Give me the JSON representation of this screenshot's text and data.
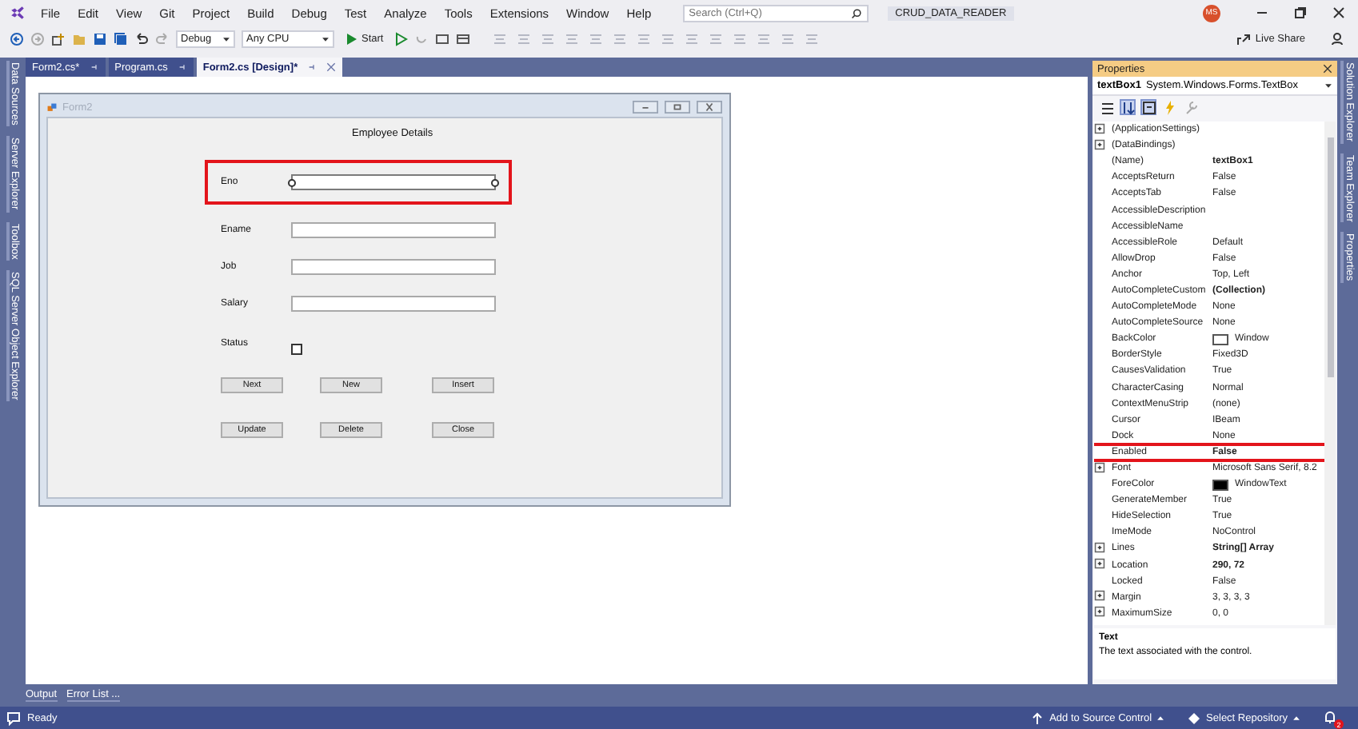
{
  "menu": [
    "File",
    "Edit",
    "View",
    "Git",
    "Project",
    "Build",
    "Debug",
    "Test",
    "Analyze",
    "Tools",
    "Extensions",
    "Window",
    "Help"
  ],
  "search": {
    "placeholder": "Search (Ctrl+Q)"
  },
  "solution_name": "CRUD_DATA_READER",
  "user_initials": "MS",
  "toolbar": {
    "configuration": "Debug",
    "platform": "Any CPU",
    "start": "Start",
    "live_share": "Live Share"
  },
  "left_tool_tabs": [
    "Data Sources",
    "Server Explorer",
    "Toolbox",
    "SQL Server Object Explorer"
  ],
  "doc_tabs": [
    {
      "label": "Form2.cs*",
      "selected": false
    },
    {
      "label": "Program.cs",
      "selected": false
    },
    {
      "label": "Form2.cs [Design]*",
      "selected": true
    }
  ],
  "form": {
    "title": "Form2",
    "heading": "Employee Details",
    "fields": [
      {
        "kind": "text",
        "label": "Eno",
        "selected": true
      },
      {
        "kind": "text",
        "label": "Ename",
        "selected": false
      },
      {
        "kind": "text",
        "label": "Job",
        "selected": false
      },
      {
        "kind": "text",
        "label": "Salary",
        "selected": false
      },
      {
        "kind": "checkbox",
        "label": "Status",
        "selected": false,
        "checked": false
      }
    ],
    "button_rows": [
      [
        "Next",
        "New",
        "Insert"
      ],
      [
        "Update",
        "Delete",
        "Close"
      ]
    ]
  },
  "properties": {
    "title": "Properties",
    "object": "textBox1",
    "type": "System.Windows.Forms.TextBox",
    "rows": [
      {
        "name": "(ApplicationSettings)",
        "expandable": true,
        "highlighted": false
      },
      {
        "name": "(DataBindings)",
        "expandable": true,
        "highlighted": false
      },
      {
        "name": "(Name)",
        "value": "textBox1",
        "expandable": false,
        "bold": true,
        "highlighted": false
      },
      {
        "name": "AcceptsReturn",
        "value": "False",
        "expandable": false,
        "bold": false,
        "highlighted": false
      },
      {
        "name": "AcceptsTab",
        "value": "False",
        "expandable": false,
        "bold": false,
        "highlighted": false
      },
      {
        "name": "AccessibleDescription",
        "expandable": false,
        "highlighted": false
      },
      {
        "name": "AccessibleName",
        "expandable": false,
        "highlighted": false
      },
      {
        "name": "AccessibleRole",
        "value": "Default",
        "expandable": false,
        "bold": false,
        "highlighted": false
      },
      {
        "name": "AllowDrop",
        "value": "False",
        "expandable": false,
        "bold": false,
        "highlighted": false
      },
      {
        "name": "Anchor",
        "value": "Top, Left",
        "expandable": false,
        "bold": false,
        "highlighted": false
      },
      {
        "name": "AutoCompleteCustom",
        "value": "(Collection)",
        "expandable": false,
        "bold": true,
        "highlighted": false
      },
      {
        "name": "AutoCompleteMode",
        "value": "None",
        "expandable": false,
        "bold": false,
        "highlighted": false
      },
      {
        "name": "AutoCompleteSource",
        "value": "None",
        "expandable": false,
        "bold": false,
        "highlighted": false
      },
      {
        "name": "BackColor",
        "value": "Window",
        "expandable": false,
        "bold": false,
        "highlighted": false,
        "color": "#ffffff"
      },
      {
        "name": "BorderStyle",
        "value": "Fixed3D",
        "expandable": false,
        "bold": false,
        "highlighted": false
      },
      {
        "name": "CausesValidation",
        "value": "True",
        "expandable": false,
        "bold": false,
        "highlighted": false
      },
      {
        "name": "CharacterCasing",
        "value": "Normal",
        "expandable": false,
        "bold": false,
        "highlighted": false
      },
      {
        "name": "ContextMenuStrip",
        "value": "(none)",
        "expandable": false,
        "bold": false,
        "highlighted": false
      },
      {
        "name": "Cursor",
        "value": "IBeam",
        "expandable": false,
        "bold": false,
        "highlighted": false
      },
      {
        "name": "Dock",
        "value": "None",
        "expandable": false,
        "bold": false,
        "highlighted": false
      },
      {
        "name": "Enabled",
        "value": "False",
        "expandable": false,
        "bold": true,
        "highlighted": true
      },
      {
        "name": "Font",
        "value": "Microsoft Sans Serif, 8.2",
        "expandable": true,
        "bold": false,
        "highlighted": false
      },
      {
        "name": "ForeColor",
        "value": "WindowText",
        "expandable": false,
        "bold": false,
        "highlighted": false,
        "color": "#000000"
      },
      {
        "name": "GenerateMember",
        "value": "True",
        "expandable": false,
        "bold": false,
        "highlighted": false
      },
      {
        "name": "HideSelection",
        "value": "True",
        "expandable": false,
        "bold": false,
        "highlighted": false
      },
      {
        "name": "ImeMode",
        "value": "NoControl",
        "expandable": false,
        "bold": false,
        "highlighted": false
      },
      {
        "name": "Lines",
        "value": "String[] Array",
        "expandable": true,
        "bold": true,
        "highlighted": false
      },
      {
        "name": "Location",
        "value": "290, 72",
        "expandable": true,
        "bold": true,
        "highlighted": false
      },
      {
        "name": "Locked",
        "value": "False",
        "expandable": false,
        "bold": false,
        "highlighted": false
      },
      {
        "name": "Margin",
        "value": "3, 3, 3, 3",
        "expandable": true,
        "bold": false,
        "highlighted": false
      },
      {
        "name": "MaximumSize",
        "value": "0, 0",
        "expandable": true,
        "bold": false,
        "highlighted": false
      }
    ],
    "description_title": "Text",
    "description": "The text associated with the control."
  },
  "right_tool_tabs": [
    "Solution Explorer",
    "Team Explorer",
    "Properties"
  ],
  "bottom_tabs": [
    "Output",
    "Error List ..."
  ],
  "status_bar": {
    "message": "Ready",
    "source_control": "Add to Source Control",
    "repository": "Select Repository",
    "notifications": "2"
  }
}
